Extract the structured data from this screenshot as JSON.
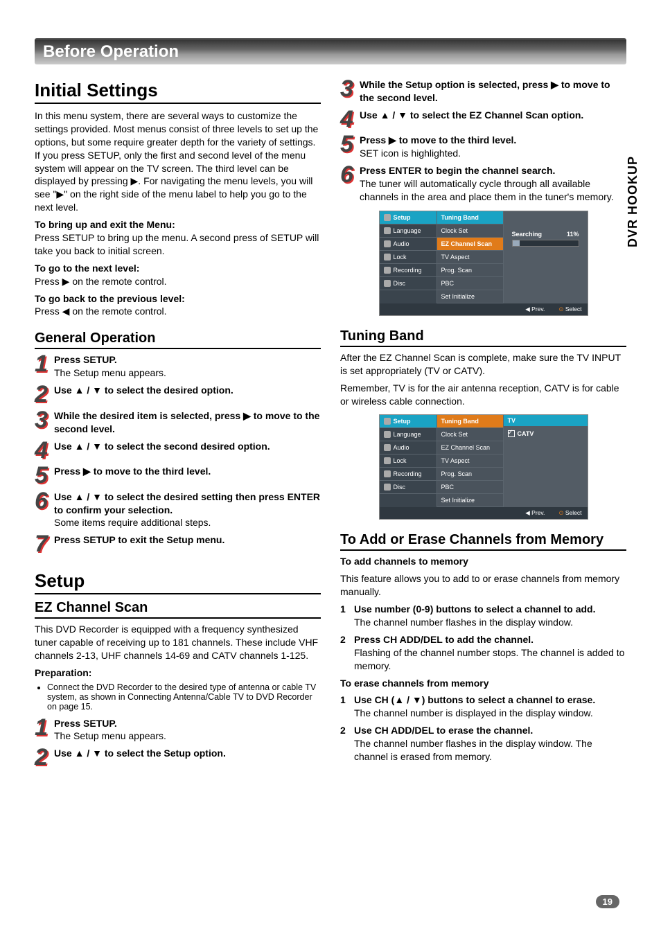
{
  "sideTab": "DVR HOOKUP",
  "pageNumber": "19",
  "sectionBar": "Before Operation",
  "left": {
    "title": "Initial Settings",
    "intro": "In this menu system, there are several ways to customize the settings provided. Most menus consist of three levels to set up the options, but some require greater depth for the variety of settings. If you press SETUP, only the first and second level of the menu system will appear on the TV screen. The third level can be displayed by pressing ▶. For navigating the menu levels, you will see \"▶\" on the right side of the menu label to help you go to the next level.",
    "bringUpHeading": "To bring up and exit the Menu:",
    "bringUpBody": "Press SETUP to bring up the menu. A second press of SETUP will take you back to initial screen.",
    "nextLevelHeading": "To go to the next level:",
    "nextLevelBody": "Press ▶ on the remote control.",
    "prevLevelHeading": "To go back to the previous level:",
    "prevLevelBody": "Press ◀ on the remote control.",
    "generalOp": "General Operation",
    "steps": [
      {
        "lead": "Press SETUP.",
        "body": "The Setup menu appears."
      },
      {
        "lead": "Use ▲ / ▼ to select the desired option.",
        "body": ""
      },
      {
        "lead": "While the desired item is selected, press ▶ to move to the second level.",
        "body": ""
      },
      {
        "lead": "Use ▲ / ▼ to select the second desired option.",
        "body": ""
      },
      {
        "lead": "Press ▶ to move to the third level.",
        "body": ""
      },
      {
        "lead": "Use ▲ / ▼ to select the desired setting then press ENTER to confirm your selection.",
        "body": "Some items require additional steps."
      },
      {
        "lead": "Press SETUP to exit the Setup menu.",
        "body": ""
      }
    ],
    "setupTitle": "Setup",
    "ezTitle": "EZ Channel Scan",
    "ezBody": "This DVD Recorder is equipped with a frequency synthesized tuner capable of receiving up to 181 channels. These include VHF channels 2-13, UHF channels 14-69 and CATV channels 1-125.",
    "prepHeading": "Preparation:",
    "prepItem": "Connect the DVD Recorder to the desired type of antenna or cable TV system, as shown in Connecting Antenna/Cable TV to DVD Recorder on page 15.",
    "setupSteps": [
      {
        "lead": "Press SETUP.",
        "body": "The Setup menu appears."
      },
      {
        "lead": "Use ▲ / ▼ to select the Setup option.",
        "body": ""
      }
    ]
  },
  "right": {
    "contSteps": [
      {
        "n": "3",
        "lead": "While the Setup option is selected, press ▶ to move to the second level.",
        "body": ""
      },
      {
        "n": "4",
        "lead": "Use ▲ / ▼ to select the EZ Channel Scan option.",
        "body": ""
      },
      {
        "n": "5",
        "lead": "Press ▶ to move to the third level.",
        "body": "SET icon is highlighted."
      },
      {
        "n": "6",
        "lead": "Press ENTER to begin the channel search.",
        "body": "The tuner will automatically cycle through all available channels in the area and place them in the tuner's memory."
      }
    ],
    "tuningTitle": "Tuning Band",
    "tuningBody1": "After the EZ Channel Scan is complete, make sure the TV INPUT is set appropriately (TV or CATV).",
    "tuningBody2": "Remember, TV is for the air antenna reception, CATV is for cable or wireless cable connection.",
    "addEraseTitle": "To Add or Erase Channels from Memory",
    "addHeading": "To add channels to memory",
    "addIntro": "This feature allows you to add to or erase channels from memory manually.",
    "addList": [
      {
        "n": "1",
        "lead": "Use number (0-9) buttons to select a channel to add.",
        "body": "The channel number flashes in the display window."
      },
      {
        "n": "2",
        "lead": "Press CH ADD/DEL to add the channel.",
        "body": "Flashing of the channel number stops. The channel is added to memory."
      }
    ],
    "eraseHeading": "To erase channels from memory",
    "eraseList": [
      {
        "n": "1",
        "lead": "Use CH (▲ / ▼) buttons to select a channel to erase.",
        "body": "The channel number is displayed in the display window."
      },
      {
        "n": "2",
        "lead": "Use CH ADD/DEL to erase the channel.",
        "body": "The channel number flashes in the display window. The channel is erased from memory."
      }
    ]
  },
  "osd": {
    "leftItems": [
      "Setup",
      "Language",
      "Audio",
      "Lock",
      "Recording",
      "Disc"
    ],
    "midItems": [
      "Tuning Band",
      "Clock Set",
      "EZ Channel Scan",
      "TV Aspect",
      "Prog. Scan",
      "PBC",
      "Set Initialize"
    ],
    "searching": "Searching",
    "percent": "11%",
    "prev": "Prev.",
    "select": "Select",
    "tv": "TV",
    "catv": "CATV"
  }
}
